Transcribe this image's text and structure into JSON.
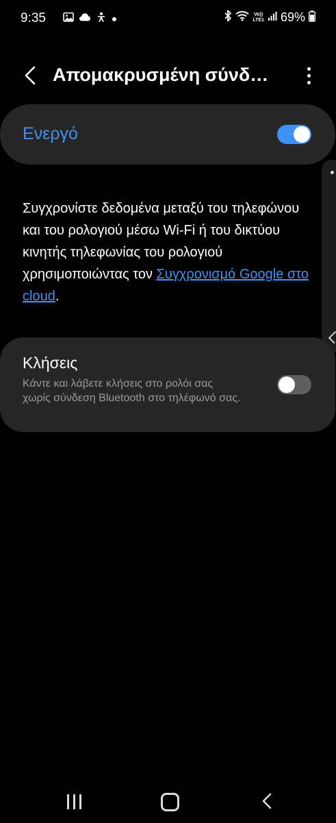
{
  "status_bar": {
    "time": "9:35",
    "left_icons": [
      "gallery-icon",
      "cloud-icon",
      "accessibility-icon",
      "notification-dot-icon"
    ],
    "right_icons": [
      "bluetooth-icon",
      "wifi-icon",
      "volte-lte-icon",
      "signal-icon"
    ],
    "volte_label": "Vo))",
    "lte_label": "LTE1",
    "battery": "69%"
  },
  "app_bar": {
    "title": "Απομακρυσμένη σύνδ…",
    "back_icon": "chevron-left-icon",
    "more_icon": "more-vertical-icon"
  },
  "master_switch": {
    "label": "Ενεργό",
    "enabled": true
  },
  "description": {
    "text": "Συγχρονίστε δεδομένα μεταξύ του τηλεφώνου και του ρολογιού μέσω Wi-Fi ή του δικτύου κινητής τηλεφωνίας του ρολογιού χρησιμοποιώντας τον ",
    "link": "Συγχρονισμό Google στο cloud",
    "suffix": "."
  },
  "calls": {
    "title": "Κλήσεις",
    "description": "Κάντε και λάβετε κλήσεις στο ρολόι σας χωρίς σύνδεση Bluetooth στο τηλέφωνό σας.",
    "enabled": false
  },
  "nav_bar": {
    "recent_icon": "recent-apps-icon",
    "home_icon": "home-icon",
    "back_icon": "back-icon"
  },
  "colors": {
    "accent": "#3e91f5",
    "card": "#262626",
    "background": "#000000",
    "secondary_text": "#9a9a9a"
  }
}
